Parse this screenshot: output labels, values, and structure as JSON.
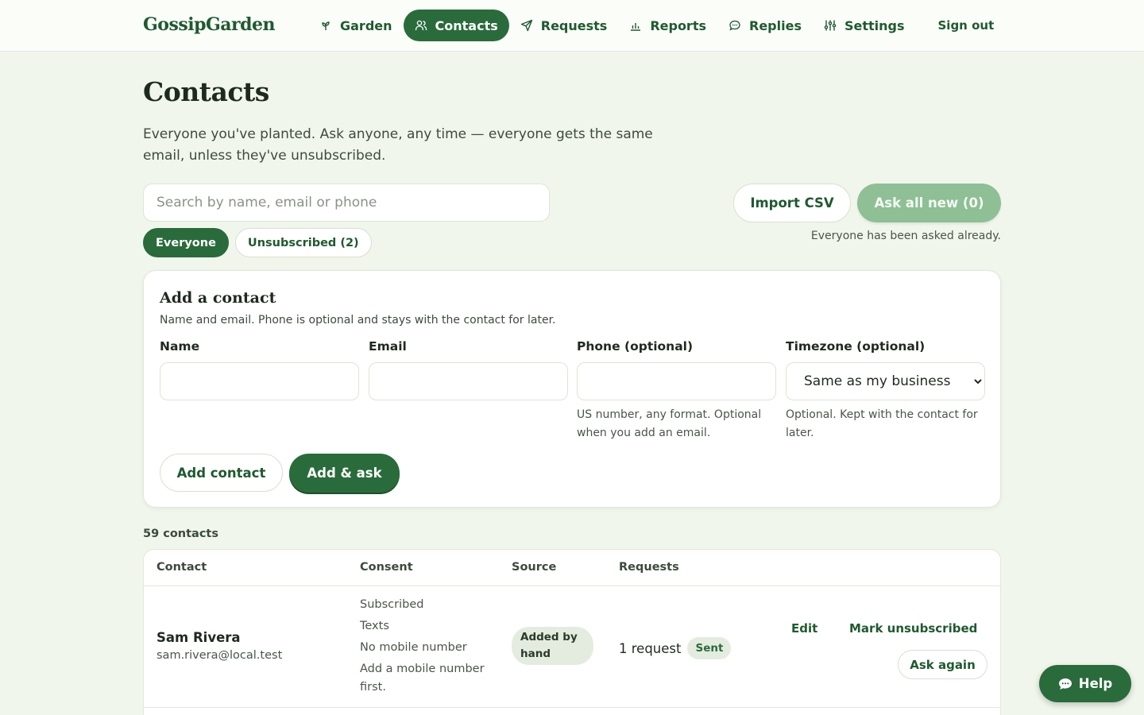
{
  "brand": "GossipGarden",
  "nav": {
    "items": [
      {
        "label": "Garden",
        "icon": "sprout-icon"
      },
      {
        "label": "Contacts",
        "icon": "people-icon",
        "active": true
      },
      {
        "label": "Requests",
        "icon": "send-icon"
      },
      {
        "label": "Reports",
        "icon": "bar-chart-icon"
      },
      {
        "label": "Replies",
        "icon": "chat-bubble-icon"
      },
      {
        "label": "Settings",
        "icon": "sliders-icon"
      }
    ],
    "sign_out": "Sign out"
  },
  "page": {
    "title": "Contacts",
    "intro": "Everyone you've planted. Ask anyone, any time — everyone gets the same email, unless they've unsubscribed."
  },
  "search": {
    "placeholder": "Search by name, email or phone",
    "value": ""
  },
  "filters": {
    "everyone": "Everyone",
    "unsubscribed": "Unsubscribed (2)"
  },
  "actions": {
    "import_csv": "Import CSV",
    "ask_all_new": "Ask all new (0)",
    "asked_note": "Everyone has been asked already."
  },
  "add_contact": {
    "title": "Add a contact",
    "subtitle": "Name and email. Phone is optional and stays with the contact for later.",
    "name_label": "Name",
    "email_label": "Email",
    "phone_label": "Phone (optional)",
    "phone_hint": "US number, any format. Optional when you add an email.",
    "timezone_label": "Timezone (optional)",
    "timezone_value": "Same as my business",
    "timezone_hint": "Optional. Kept with the contact for later.",
    "add_button": "Add contact",
    "add_ask_button": "Add & ask"
  },
  "contacts": {
    "count": "59 contacts",
    "columns": [
      "Contact",
      "Consent",
      "Source",
      "Requests"
    ],
    "rows": [
      {
        "name": "Sam Rivera",
        "email": "sam.rivera@local.test",
        "consent": [
          "Subscribed",
          "Texts",
          "No mobile number",
          "Add a mobile number first."
        ],
        "source": "Added by hand",
        "requests": "1 request",
        "status": "Sent",
        "edit": "Edit",
        "mark_unsubscribed": "Mark unsubscribed",
        "ask_again": "Ask again"
      }
    ]
  },
  "help": "Help",
  "colors": {
    "accent": "#2a6b3b",
    "background": "#f1f6ec",
    "muted_button": "#8ebf95"
  }
}
